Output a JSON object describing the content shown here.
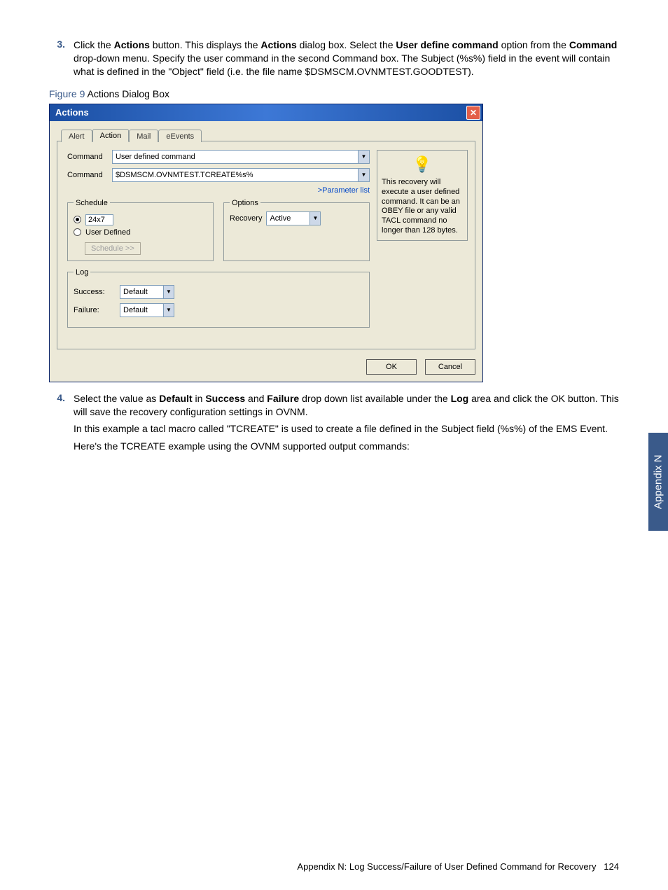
{
  "step3": {
    "num": "3.",
    "text_prefix": "Click the ",
    "b1": "Actions",
    "t2": " button. This displays the ",
    "b2": "Actions",
    "t3": " dialog box. Select the ",
    "b3": "User define command",
    "t4": " option from the ",
    "b4": "Command",
    "t5": " drop-down menu. Specify the user command in the second Command box. The Subject (%s%) field in the event will contain  what is defined in the \"Object\" field (i.e. the file name $DSMSCM.OVNMTEST.GOODTEST)."
  },
  "figcaption": {
    "label": "Figure 9",
    "text": " Actions Dialog Box"
  },
  "dialog": {
    "title": "Actions",
    "tabs": {
      "alert": "Alert",
      "action": "Action",
      "mail": "Mail",
      "events": "eEvents"
    },
    "labels": {
      "command1": "Command",
      "command2": "Command"
    },
    "command1_value": "User defined command",
    "command2_value": "$DSMSCM.OVNMTEST.TCREATE%s%",
    "param_link": ">Parameter list",
    "schedule": {
      "legend": "Schedule",
      "opt_24x7": "24x7",
      "opt_user": "User Defined",
      "btn": "Schedule >>"
    },
    "options": {
      "legend": "Options",
      "recovery_label": "Recovery",
      "recovery_value": "Active"
    },
    "log": {
      "legend": "Log",
      "success_label": "Success:",
      "failure_label": "Failure:",
      "success_value": "Default",
      "failure_value": "Default"
    },
    "info": "This recovery will execute a user defined command. It can be an OBEY file or any valid TACL command no longer than 128 bytes.",
    "ok": "OK",
    "cancel": "Cancel"
  },
  "step4": {
    "num": "4.",
    "t1": "Select the value as ",
    "b1": "Default",
    "t2": " in ",
    "b2": "Success",
    "t3": " and ",
    "b3": "Failure",
    "t4": " drop down list available under the ",
    "b4": "Log",
    "t5": " area and click the OK button. This will save the recovery configuration settings in OVNM.",
    "p2": "In this example a tacl macro called \"TCREATE\" is used to create a file defined in the Subject field (%s%) of the EMS Event.",
    "p3": "Here's the TCREATE example using the OVNM supported output commands:"
  },
  "side_tab": "Appendix N",
  "footer": {
    "text": "Appendix N: Log Success/Failure of User Defined Command for Recovery",
    "page": "124"
  }
}
